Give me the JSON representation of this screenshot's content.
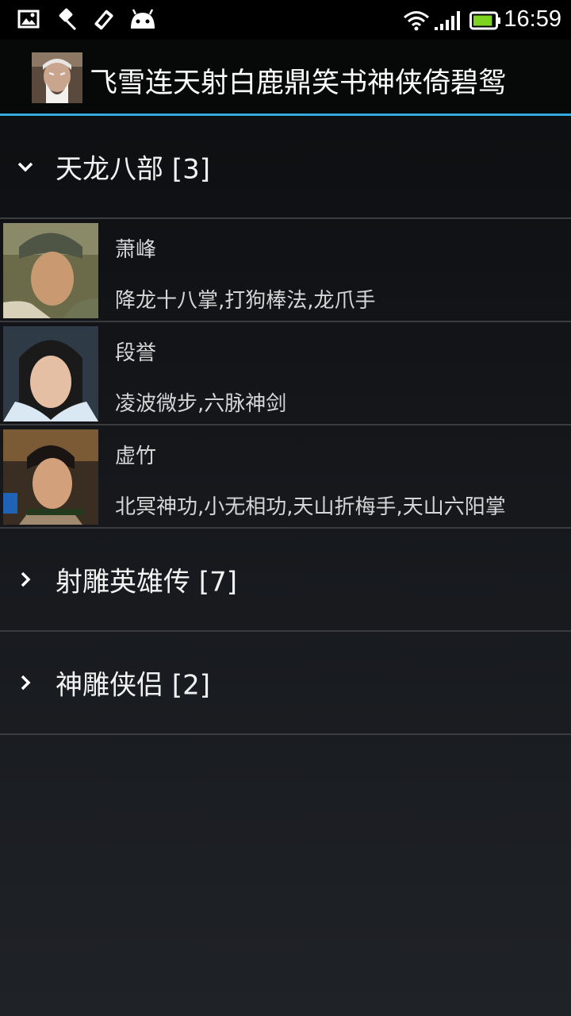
{
  "status_bar": {
    "time": "16:59",
    "left_icons": [
      "image-icon",
      "pin-icon",
      "debug-icon",
      "android-icon"
    ],
    "right_icons": [
      "wifi-icon",
      "signal-icon",
      "battery-icon"
    ],
    "battery_level": 0.9
  },
  "action_bar": {
    "app_icon": "old-man-avatar",
    "title": "飞雪连天射白鹿鼎笑书神侠倚碧鸳",
    "divider_color": "#33a9dd"
  },
  "groups": [
    {
      "label": "天龙八部 [3]",
      "expanded": true,
      "children": [
        {
          "name": "萧峰",
          "skills": "降龙十八掌,打狗棒法,龙爪手",
          "avatar": "xiaofeng-avatar"
        },
        {
          "name": "段誉",
          "skills": "凌波微步,六脉神剑",
          "avatar": "duanyu-avatar"
        },
        {
          "name": "虚竹",
          "skills": "北冥神功,小无相功,天山折梅手,天山六阳掌",
          "avatar": "xuzhu-avatar"
        }
      ]
    },
    {
      "label": "射雕英雄传 [7]",
      "expanded": false
    },
    {
      "label": "神雕侠侣 [2]",
      "expanded": false
    }
  ]
}
